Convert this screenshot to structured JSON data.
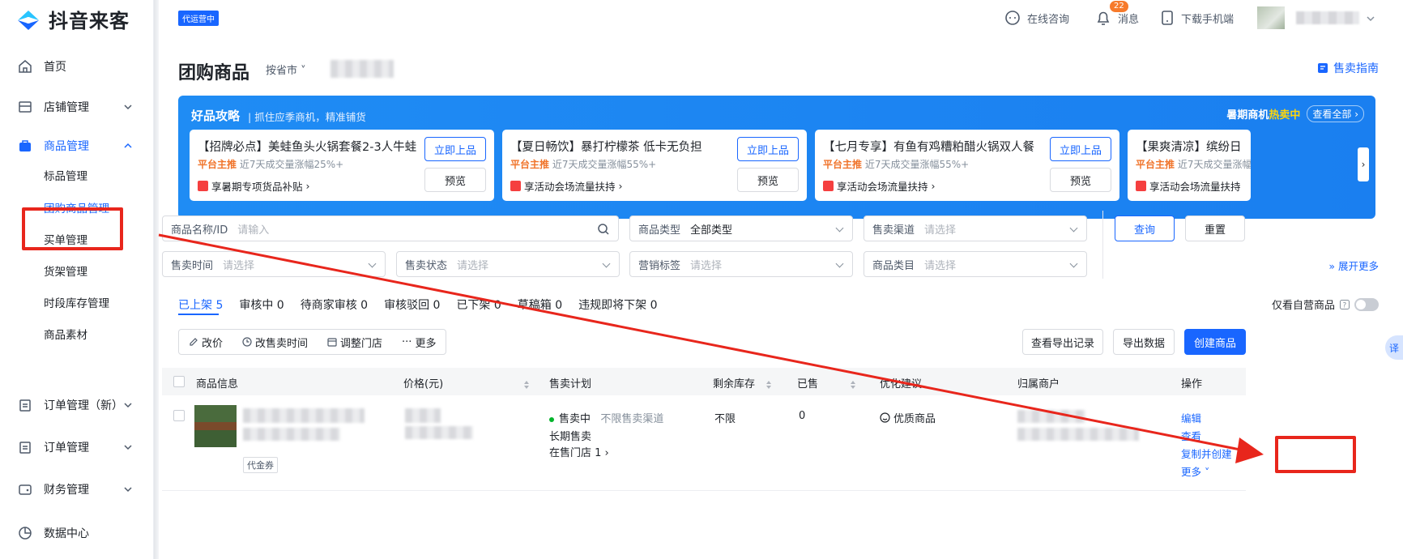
{
  "app": {
    "logo_text": "抖音来客",
    "op_badge": "代运营中"
  },
  "topbar": {
    "consult": "在线咨询",
    "messages": "消息",
    "message_count": "22",
    "download": "下载手机端"
  },
  "sidebar": {
    "items": [
      {
        "label": "首页",
        "icon": "home-icon"
      },
      {
        "label": "店铺管理",
        "icon": "store-icon"
      },
      {
        "label": "商品管理",
        "icon": "bag-icon"
      },
      {
        "label": "订单管理（新）",
        "icon": "clipboard-icon"
      },
      {
        "label": "订单管理",
        "icon": "clipboard-icon"
      },
      {
        "label": "财务管理",
        "icon": "wallet-icon"
      },
      {
        "label": "数据中心",
        "icon": "pie-icon"
      }
    ],
    "sub_items": [
      "标品管理",
      "团购商品管理",
      "买单管理",
      "货架管理",
      "时段库存管理",
      "商品素材"
    ]
  },
  "page": {
    "title": "团购商品",
    "province": "按省市",
    "guide": "售卖指南"
  },
  "banner": {
    "title": "好品攻略",
    "subtitle": "抓住应季商机，精准铺货",
    "hot_prefix": "暑期商机",
    "hot_word": "热卖中",
    "view_all": "查看全部",
    "cards": [
      {
        "title": "【招牌必点】美蛙鱼头火锅套餐2-3人牛蛙...",
        "push": "平台主推",
        "stat": "近7天成交量涨幅25%+",
        "foot": "享暑期专项货品补贴"
      },
      {
        "title": "【夏日畅饮】暴打柠檬茶 低卡无负担",
        "push": "平台主推",
        "stat": "近7天成交量涨幅55%+",
        "foot": "享活动会场流量扶持"
      },
      {
        "title": "【七月专享】有鱼有鸡糟粕醋火锅双人餐",
        "push": "平台主推",
        "stat": "近7天成交量涨幅55%+",
        "foot": "享活动会场流量扶持"
      },
      {
        "title": "【果爽清凉】缤纷日",
        "push": "平台主推",
        "stat": "近7天成交量涨幅",
        "foot": "享活动会场流量扶持"
      }
    ],
    "btn_list": "立即上品",
    "btn_preview": "预览"
  },
  "filters": {
    "name_label": "商品名称/ID",
    "name_placeholder": "请输入",
    "type_label": "商品类型",
    "type_value": "全部类型",
    "channel_label": "售卖渠道",
    "time_label": "售卖时间",
    "status_label": "售卖状态",
    "tag_label": "营销标签",
    "category_label": "商品类目",
    "select_placeholder": "请选择",
    "query": "查询",
    "reset": "重置",
    "expand": "展开更多"
  },
  "tabs": [
    "已上架 5",
    "审核中 0",
    "待商家审核 0",
    "审核驳回 0",
    "已下架 0",
    "草稿箱 0",
    "违规即将下架 0"
  ],
  "self_operated": "仅看自营商品",
  "bulk": {
    "price": "改价",
    "time": "改售卖时间",
    "store": "调整门店",
    "more": "更多"
  },
  "actions": {
    "export_log": "查看导出记录",
    "export": "导出数据",
    "create": "创建商品"
  },
  "table": {
    "headers": [
      "商品信息",
      "价格(元)",
      "售卖计划",
      "剩余库存",
      "已售",
      "优化建议",
      "归属商户",
      "操作"
    ],
    "row": {
      "tag": "代金券",
      "status": "售卖中",
      "channel": "不限售卖渠道",
      "period": "长期售卖",
      "stores": "在售门店 1",
      "stock": "不限",
      "sold": "0",
      "suggest": "优质商品",
      "ops": [
        "编辑",
        "查看",
        "复制并创建",
        "更多"
      ]
    }
  },
  "translate": "译",
  "colors": {
    "accent": "#1966ff",
    "annotation": "#e8261c"
  }
}
